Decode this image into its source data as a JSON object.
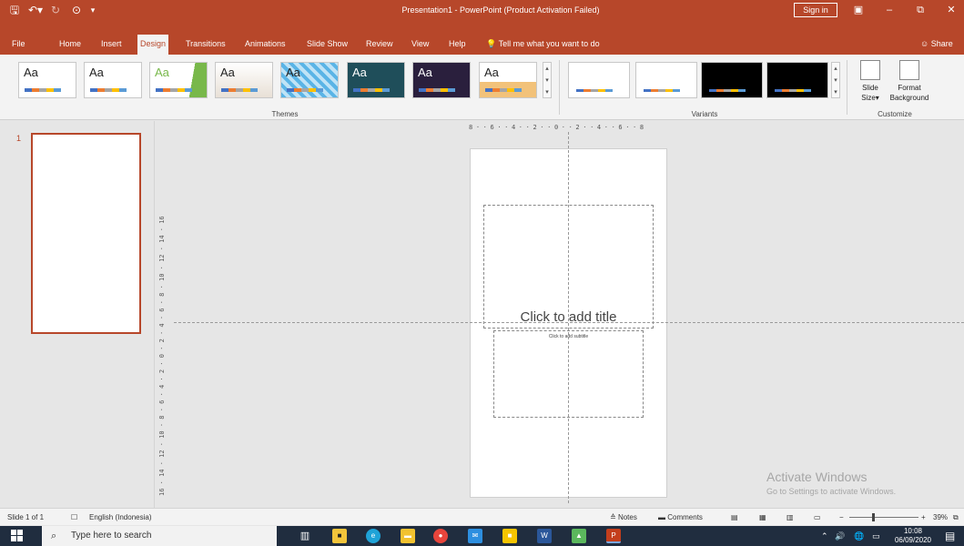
{
  "titlebar": {
    "title": "Presentation1  -  PowerPoint (Product Activation Failed)",
    "sign_in": "Sign in",
    "save_icon": "save-icon",
    "undo_icon": "undo-icon",
    "redo_icon": "redo-icon",
    "customize_icon": "customize-qat-icon"
  },
  "tabs": [
    "File",
    "Home",
    "Insert",
    "Design",
    "Transitions",
    "Animations",
    "Slide Show",
    "Review",
    "View",
    "Help"
  ],
  "active_tab": "Design",
  "tell_me": "Tell me what you want to do",
  "share": "Share",
  "ribbon": {
    "theme_label": "Aa",
    "themes_group": "Themes",
    "variants_group": "Variants",
    "customize_group": "Customize",
    "slide_size": "Slide Size",
    "format_background_line1": "Format",
    "format_background_line2": "Background",
    "slide_size_line1": "Slide",
    "slide_size_line2": "Size"
  },
  "thumbnails": {
    "slide_number": "1"
  },
  "slide": {
    "title_placeholder": "Click to add title",
    "subtitle_placeholder": "Click to add subtitle"
  },
  "rulers": {
    "horizontal": "8 · · 6 · · 4 · · 2 · · 0 · · 2 · · 4 · · 6 · · 8",
    "vertical": "16 · 14 · 12 · 10 · 8 · 6 · 4 · 2 · 0 · 2 · 4 · 6 · 8 · 10 · 12 · 14 · 16"
  },
  "watermark": {
    "line1": "Activate Windows",
    "line2": "Go to Settings to activate Windows."
  },
  "statusbar": {
    "slide_count": "Slide 1 of 1",
    "language": "English (Indonesia)",
    "notes": "Notes",
    "comments": "Comments",
    "zoom": "39%"
  },
  "taskbar": {
    "search_placeholder": "Type here to search",
    "time": "10:08",
    "date": "06/09/2020"
  },
  "colors": {
    "accent": "#b7472a",
    "ribbon_bg": "#f3f3f3",
    "canvas_bg": "#e6e6e6",
    "taskbar_bg": "#202d3f"
  }
}
